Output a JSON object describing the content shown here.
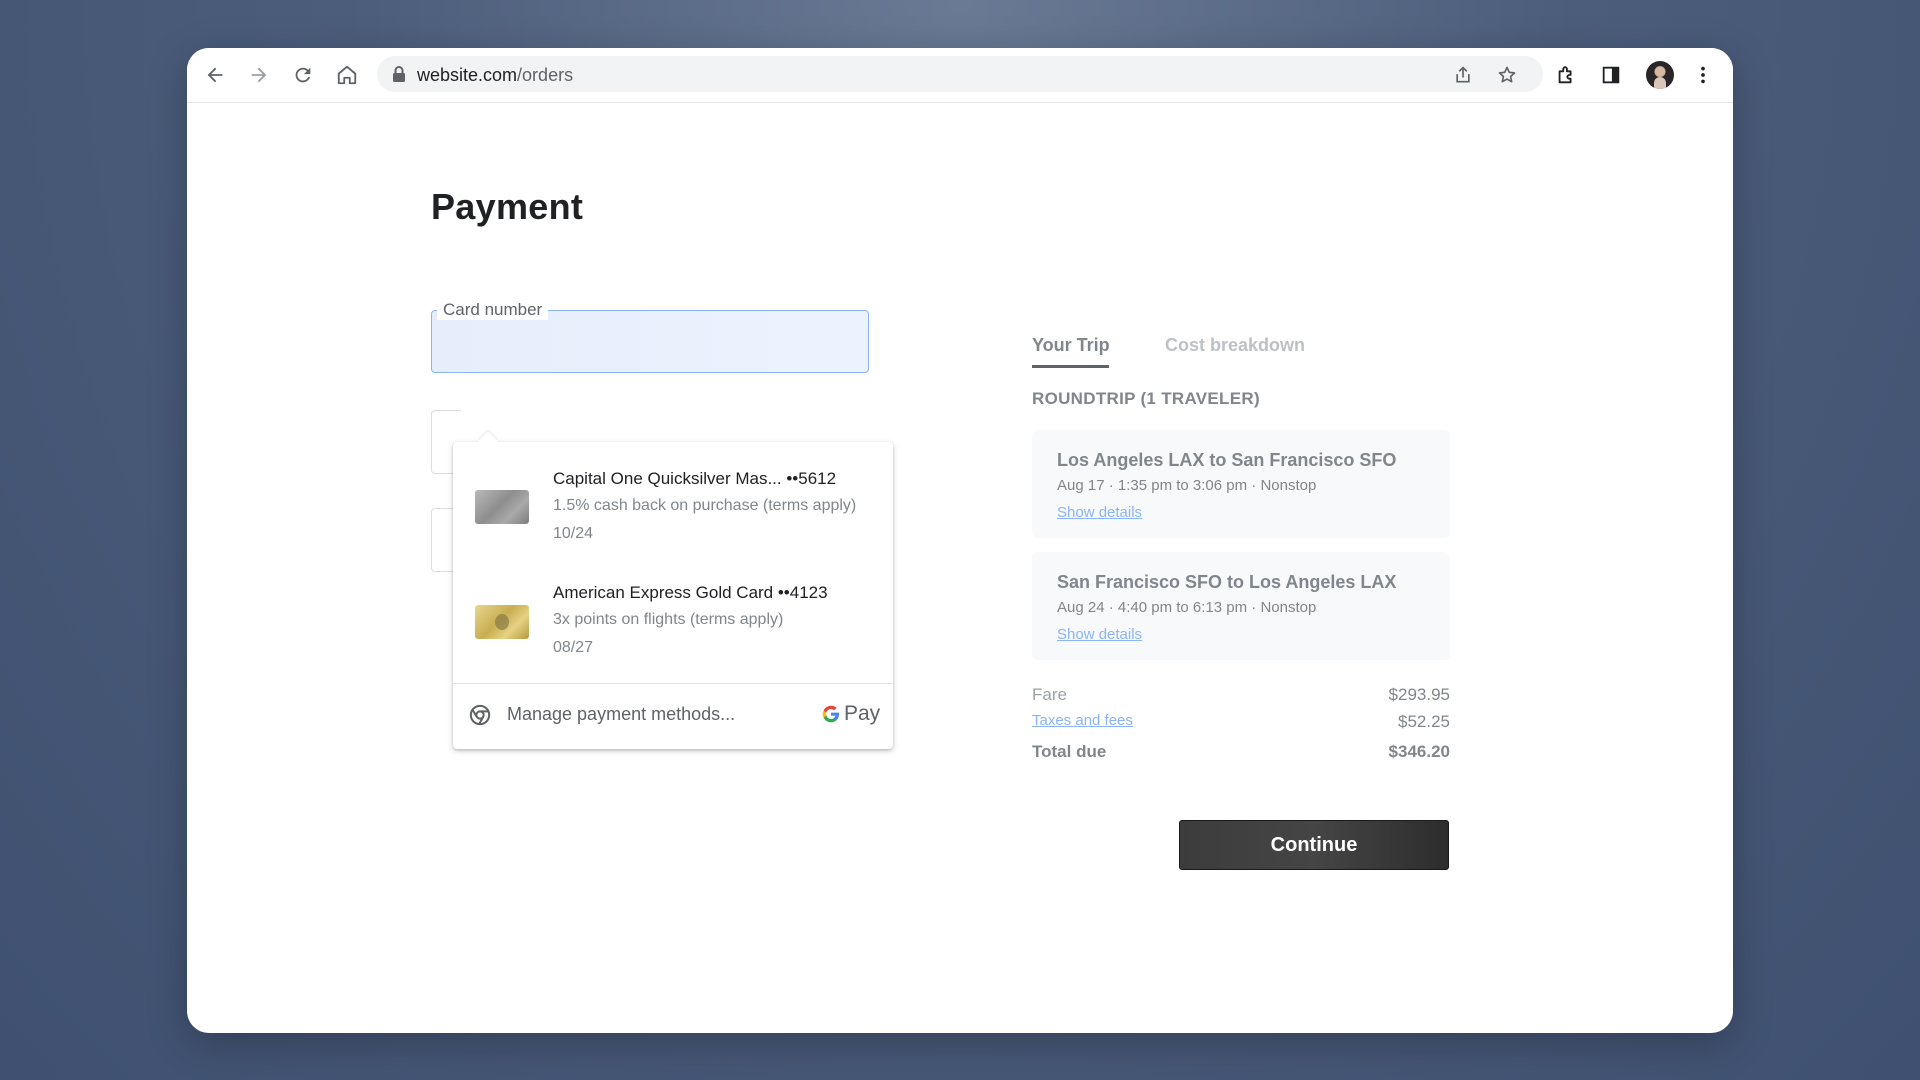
{
  "browser": {
    "url_host": "website.com",
    "url_path": "/orders"
  },
  "page": {
    "title": "Payment"
  },
  "form": {
    "card_number_label": "Card number"
  },
  "autofill": {
    "cards": [
      {
        "name": "Capital One Quicksilver Mas... ••5612",
        "benefit": "1.5% cash back on purchase (terms apply)",
        "expiry": "10/24"
      },
      {
        "name": "American Express Gold Card ••4123",
        "benefit": "3x points on flights (terms apply)",
        "expiry": "08/27"
      }
    ],
    "manage_label": "Manage payment methods...",
    "gpay_label": "Pay"
  },
  "summary": {
    "tabs": [
      {
        "label": "Your Trip"
      },
      {
        "label": "Cost breakdown"
      }
    ],
    "trip_heading": "ROUNDTRIP (1 TRAVELER)",
    "flights": [
      {
        "title": "Los Angeles LAX to San Francisco SFO",
        "info": "Aug 17 · 1:35 pm to 3:06 pm · Nonstop",
        "details_link": "Show details"
      },
      {
        "title": "San Francisco SFO to Los Angeles LAX",
        "info": "Aug 24 · 4:40 pm to 6:13 pm · Nonstop",
        "details_link": "Show details"
      }
    ],
    "fare_label": "Fare",
    "fare_value": "$293.95",
    "taxes_label": "Taxes and fees",
    "taxes_value": "$52.25",
    "total_label": "Total due",
    "total_value": "$346.20"
  },
  "actions": {
    "continue_label": "Continue"
  }
}
